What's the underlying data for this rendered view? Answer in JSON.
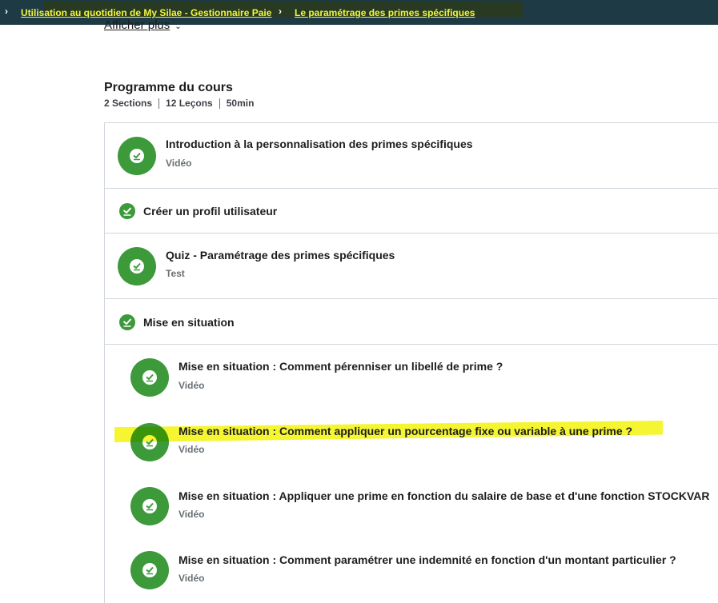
{
  "breadcrumb": {
    "item1": "Utilisation au quotidien de My Silae - Gestionnaire Paie",
    "item2": "Le paramétrage des primes spécifiques"
  },
  "show_more": "Afficher plus",
  "program": {
    "title": "Programme du cours",
    "stats": [
      "2 Sections",
      "12 Leçons",
      "50min"
    ]
  },
  "lessons": [
    {
      "title": "Introduction à la personnalisation des primes spécifiques",
      "type": "Vidéo"
    },
    {
      "title": "Créer un profil utilisateur"
    },
    {
      "title": "Quiz - Paramétrage des primes spécifiques",
      "type": "Test"
    },
    {
      "title": "Mise en situation"
    },
    {
      "title": "Mise en situation : Comment pérenniser un libellé de prime ?",
      "type": "Vidéo"
    },
    {
      "title": "Mise en situation : Comment appliquer un pourcentage fixe ou variable à une prime ?",
      "type": "Vidéo"
    },
    {
      "title": "Mise en situation : Appliquer une prime en fonction du salaire de base et d'une fonction STOCKVAR",
      "type": "Vidéo"
    },
    {
      "title": "Mise en situation : Comment paramétrer une indemnité en fonction d'un montant particulier ?",
      "type": "Vidéo"
    }
  ],
  "colors": {
    "check_green": "#3c9a3b",
    "highlight": "#f5f520",
    "topbar": "#1e3a44"
  },
  "icons": {
    "breadcrumb_separator": "chevron-right-icon",
    "completed": "check-circle-icon"
  }
}
